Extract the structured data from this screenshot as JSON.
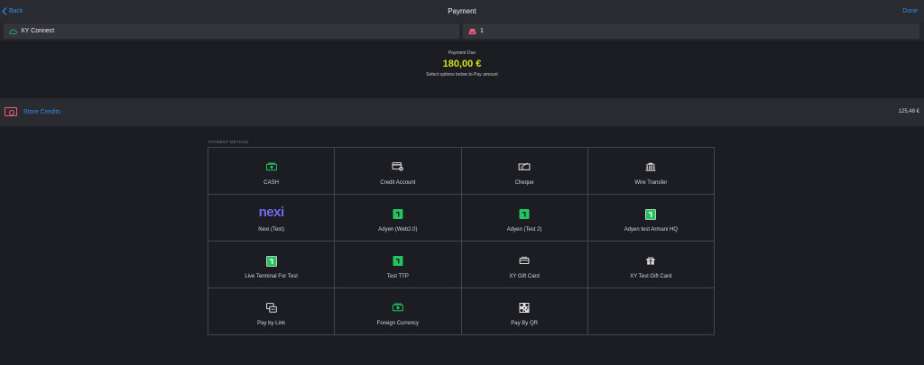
{
  "nav": {
    "back_label": "Back",
    "title": "Payment",
    "done_label": "Done"
  },
  "status": {
    "connection_label": "XY Connect",
    "register_value": "1"
  },
  "payment_due": {
    "label": "Payment Due",
    "amount": "180,00 €",
    "instruction": "Select options below to Pay amount"
  },
  "store_credits": {
    "label": "Store Credits",
    "amount": "125,48 €"
  },
  "payment_method": {
    "section_title": "PAYMENT METHOD",
    "methods": [
      {
        "label": "CASH",
        "icon": "cash-icon"
      },
      {
        "label": "Credit Account",
        "icon": "credit-account-icon"
      },
      {
        "label": "Cheque",
        "icon": "cheque-icon"
      },
      {
        "label": "Wire Transfer",
        "icon": "bank-icon"
      },
      {
        "label": "Nexi (Test)",
        "icon": "nexi-logo",
        "logo_text": "nexi"
      },
      {
        "label": "Adyen (Web2.0)",
        "icon": "adyen-icon"
      },
      {
        "label": "Adyen (Test 2)",
        "icon": "adyen-icon"
      },
      {
        "label": "Adyen test Armani HQ",
        "icon": "adyen-icon"
      },
      {
        "label": "Live Terminal For Test",
        "icon": "adyen-icon"
      },
      {
        "label": "Test TTP",
        "icon": "adyen-icon"
      },
      {
        "label": "XY Gift Card",
        "icon": "gift-card-icon"
      },
      {
        "label": "XY Test Gift Card",
        "icon": "gift-icon"
      },
      {
        "label": "Pay by Link",
        "icon": "pay-link-icon"
      },
      {
        "label": "Foreign Currency",
        "icon": "foreign-currency-icon"
      },
      {
        "label": "Pay By QR",
        "icon": "qr-code-icon"
      }
    ]
  },
  "colors": {
    "accent": "#2f8fe8",
    "due_amount": "#d4e21a",
    "store_credit_icon": "#ef5c7c",
    "payment_green": "#21c45d",
    "nexi": "#6f6cf0"
  }
}
